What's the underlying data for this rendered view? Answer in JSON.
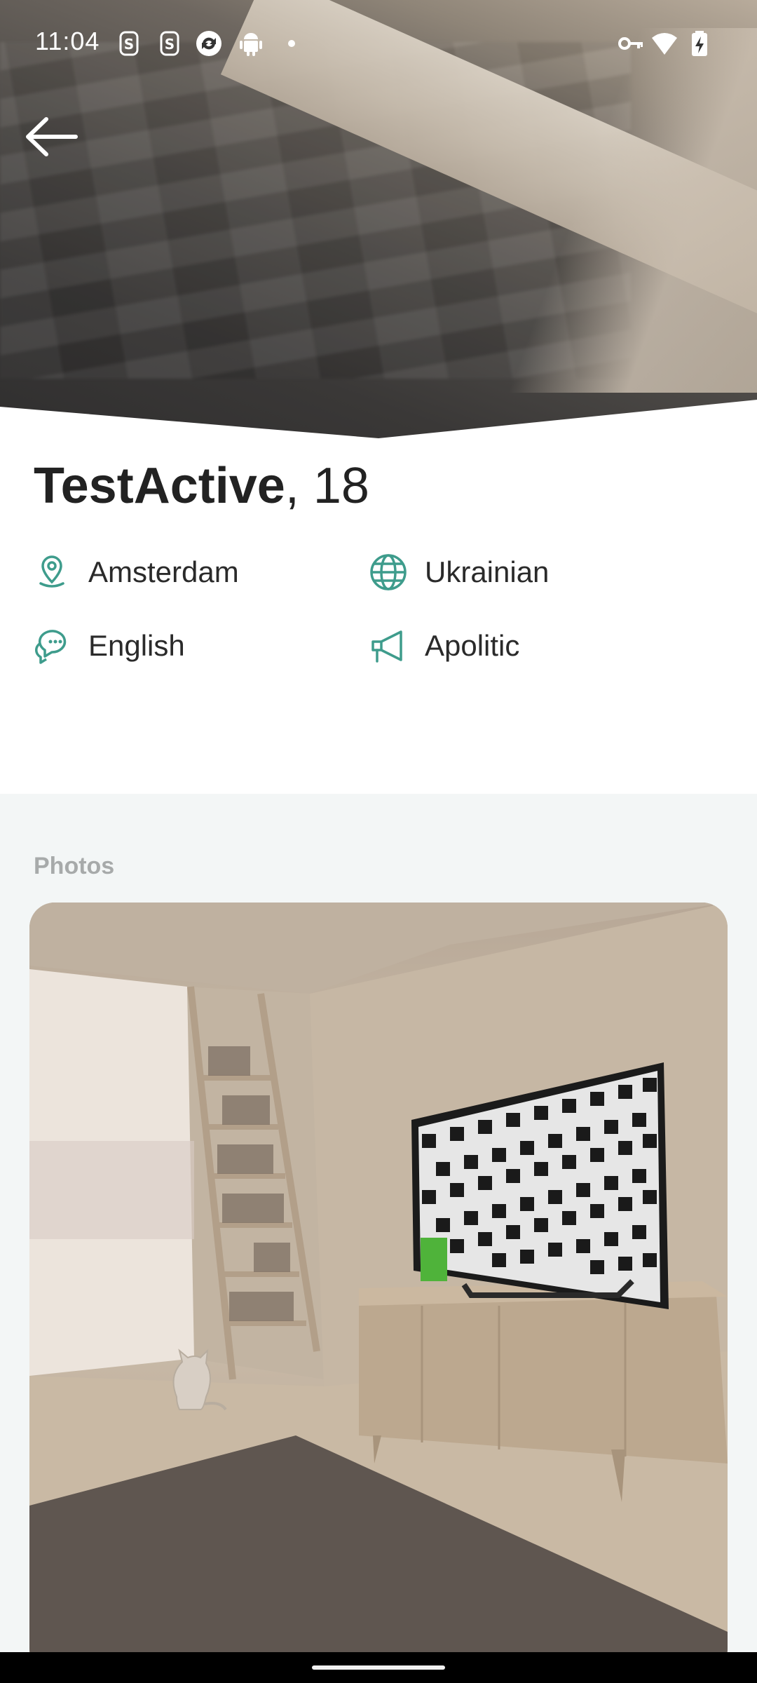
{
  "status_bar": {
    "time": "11:04",
    "left_icons": [
      "s-sim-icon",
      "s-sim-icon",
      "sync-icon",
      "android-icon",
      "dot-icon"
    ],
    "right_icons": [
      "vpn-key-icon",
      "wifi-icon",
      "battery-charging-icon"
    ]
  },
  "profile": {
    "name": "TestActive",
    "age_suffix": ", 18",
    "details": [
      {
        "icon": "location-pin-icon",
        "label": "Amsterdam"
      },
      {
        "icon": "globe-icon",
        "label": "Ukrainian"
      },
      {
        "icon": "chat-bubbles-icon",
        "label": "English"
      },
      {
        "icon": "megaphone-icon",
        "label": "Apolitic"
      }
    ]
  },
  "photos": {
    "title": "Photos"
  },
  "colors": {
    "accent": "#3e9c8c",
    "text_primary": "#222222",
    "section_bg": "#f3f6f6",
    "section_title": "#a7aaaa"
  }
}
